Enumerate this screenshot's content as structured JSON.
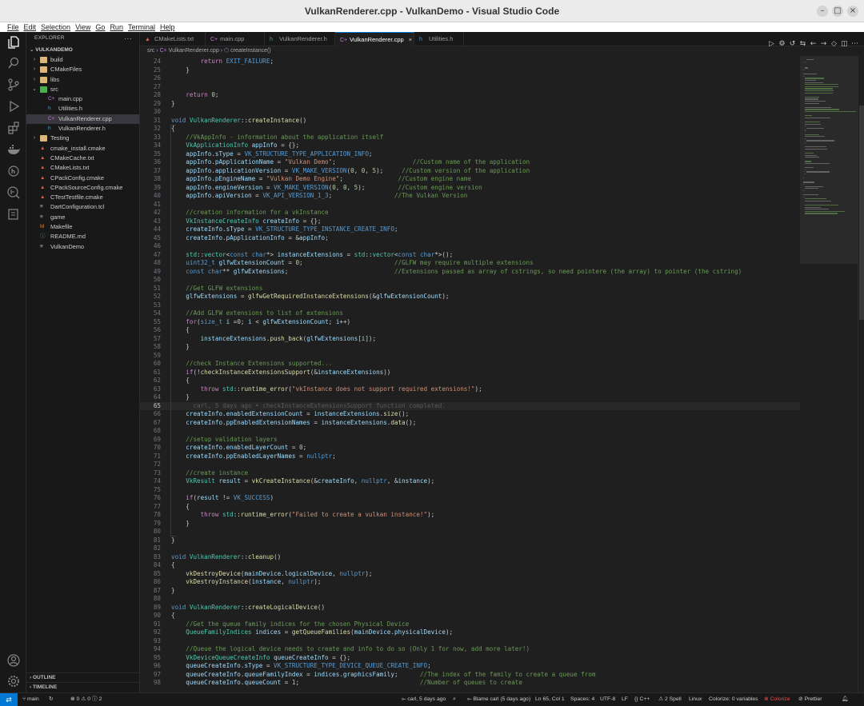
{
  "window": {
    "title": "VulkanRenderer.cpp - VulkanDemo - Visual Studio Code"
  },
  "menu": [
    "File",
    "Edit",
    "Selection",
    "View",
    "Go",
    "Run",
    "Terminal",
    "Help"
  ],
  "activity_icons": [
    "explorer-icon",
    "search-icon",
    "source-control-icon",
    "run-debug-icon",
    "extensions-icon",
    "docker-icon",
    "git-graph-icon",
    "gitlens-icon",
    "testing-icon",
    "account-icon",
    "settings-gear-icon"
  ],
  "sidebar": {
    "header": "EXPLORER",
    "more": "···",
    "root": "VULKANDEMO",
    "items": [
      {
        "name": "build",
        "kind": "folder",
        "depth": 0,
        "chevron": "›"
      },
      {
        "name": "CMakeFiles",
        "kind": "folder",
        "depth": 0,
        "chevron": "›"
      },
      {
        "name": "libs",
        "kind": "folder",
        "depth": 0,
        "chevron": "›"
      },
      {
        "name": "src",
        "kind": "folder-open",
        "depth": 0,
        "chevron": "⌄"
      },
      {
        "name": "main.cpp",
        "kind": "cpp",
        "depth": 1
      },
      {
        "name": "Utilities.h",
        "kind": "h",
        "depth": 1
      },
      {
        "name": "VulkanRenderer.cpp",
        "kind": "cpp",
        "depth": 1,
        "active": true
      },
      {
        "name": "VulkanRenderer.h",
        "kind": "h",
        "depth": 1
      },
      {
        "name": "Testing",
        "kind": "folder",
        "depth": 0,
        "chevron": "›"
      },
      {
        "name": "cmake_install.cmake",
        "kind": "cmake",
        "depth": 0
      },
      {
        "name": "CMakeCache.txt",
        "kind": "cmake",
        "depth": 0
      },
      {
        "name": "CMakeLists.txt",
        "kind": "cmake",
        "depth": 0
      },
      {
        "name": "CPackConfig.cmake",
        "kind": "cmake",
        "depth": 0
      },
      {
        "name": "CPackSourceConfig.cmake",
        "kind": "cmake",
        "depth": 0
      },
      {
        "name": "CTestTestfile.cmake",
        "kind": "cmake",
        "depth": 0
      },
      {
        "name": "DartConfiguration.tcl",
        "kind": "file",
        "depth": 0
      },
      {
        "name": "game",
        "kind": "file",
        "depth": 0
      },
      {
        "name": "Makefile",
        "kind": "makefile",
        "depth": 0
      },
      {
        "name": "README.md",
        "kind": "md",
        "depth": 0
      },
      {
        "name": "VulkanDemo",
        "kind": "file",
        "depth": 0
      }
    ],
    "outline": "OUTLINE",
    "timeline": "TIMELINE"
  },
  "tabs": [
    {
      "label": "CMakeLists.txt",
      "icon": "cmake"
    },
    {
      "label": "main.cpp",
      "icon": "cpp"
    },
    {
      "label": "VulkanRenderer.h",
      "icon": "h"
    },
    {
      "label": "VulkanRenderer.cpp",
      "icon": "cpp",
      "active": true,
      "close": "×"
    },
    {
      "label": "Utilities.h",
      "icon": "h"
    }
  ],
  "breadcrumb": {
    "folder": "src",
    "file": "VulkanRenderer.cpp",
    "symbol": "createInstance()"
  },
  "editor": {
    "current_line": 65,
    "lines": [
      {
        "n": 24,
        "code": "        return EXIT_FAILURE;"
      },
      {
        "n": 25,
        "code": "    }"
      },
      {
        "n": 26,
        "code": ""
      },
      {
        "n": 27,
        "code": ""
      },
      {
        "n": 28,
        "code": "    return 0;"
      },
      {
        "n": 29,
        "code": "}"
      },
      {
        "n": 30,
        "code": ""
      },
      {
        "n": 31,
        "code": "void VulkanRenderer::createInstance()"
      },
      {
        "n": 32,
        "code": "{"
      },
      {
        "n": 33,
        "code": "    //VkAppInfo - information about the application itself"
      },
      {
        "n": 34,
        "code": "    VkApplicationInfo appInfo = {};"
      },
      {
        "n": 35,
        "code": "    appInfo.sType = VK_STRUCTURE_TYPE_APPLICATION_INFO;"
      },
      {
        "n": 36,
        "code": "    appInfo.pApplicationName = \"Vulkan Demo\";                     //Custom name of the application"
      },
      {
        "n": 37,
        "code": "    appInfo.applicationVersion = VK_MAKE_VERSION(0, 0, 5);     //Custom version of the application"
      },
      {
        "n": 38,
        "code": "    appInfo.pEngineName = \"Vulkan Demo Engine\";               //Custom engine name"
      },
      {
        "n": 39,
        "code": "    appInfo.engineVersion = VK_MAKE_VERSION(0, 0, 5);         //Custom engine version"
      },
      {
        "n": 40,
        "code": "    appInfo.apiVersion = VK_API_VERSION_1_3;                 //The Vulkan Version"
      },
      {
        "n": 41,
        "code": ""
      },
      {
        "n": 42,
        "code": "    //creation information for a vkInstance"
      },
      {
        "n": 43,
        "code": "    VkInstanceCreateInfo createInfo = {};"
      },
      {
        "n": 44,
        "code": "    createInfo.sType = VK_STRUCTURE_TYPE_INSTANCE_CREATE_INFO;"
      },
      {
        "n": 45,
        "code": "    createInfo.pApplicationInfo = &appInfo;"
      },
      {
        "n": 46,
        "code": ""
      },
      {
        "n": 47,
        "code": "    std::vector<const char*> instanceExtensions = std::vector<const char*>();"
      },
      {
        "n": 48,
        "code": "    uint32_t glfwExtensionCount = 0;                         //GLFW may require multiple extensions"
      },
      {
        "n": 49,
        "code": "    const char** glfwExtensions;                             //Extensions passed as array of cstrings, so need pointere (the array) to pointer (the cstring)"
      },
      {
        "n": 50,
        "code": ""
      },
      {
        "n": 51,
        "code": "    //Get GLFW extensions"
      },
      {
        "n": 52,
        "code": "    glfwExtensions = glfwGetRequiredInstanceExtensions(&glfwExtensionCount);"
      },
      {
        "n": 53,
        "code": ""
      },
      {
        "n": 54,
        "code": "    //Add GLFW extensions to list of extensions"
      },
      {
        "n": 55,
        "code": "    for(size_t i =0; i < glfwExtensionCount; i++)"
      },
      {
        "n": 56,
        "code": "    {"
      },
      {
        "n": 57,
        "code": "        instanceExtensions.push_back(glfwExtensions[i]);"
      },
      {
        "n": 58,
        "code": "    }"
      },
      {
        "n": 59,
        "code": ""
      },
      {
        "n": 60,
        "code": "    //check Instance Extensions supported..."
      },
      {
        "n": 61,
        "code": "    if(!checkInstanceExtensionsSupport(&instanceExtensions))"
      },
      {
        "n": 62,
        "code": "    {"
      },
      {
        "n": 63,
        "code": "        throw std::runtime_error(\"vkInstance does not support required extensions!\");"
      },
      {
        "n": 64,
        "code": "    }"
      },
      {
        "n": 65,
        "code": "",
        "ghost": "      carl, 5 days ago • checkInstanceExtensionsSupport function completed."
      },
      {
        "n": 66,
        "code": "    createInfo.enabledExtensionCount = instanceExtensions.size();"
      },
      {
        "n": 67,
        "code": "    createInfo.ppEnabledExtensionNames = instanceExtensions.data();"
      },
      {
        "n": 68,
        "code": ""
      },
      {
        "n": 69,
        "code": "    //setup validation layers"
      },
      {
        "n": 70,
        "code": "    createInfo.enabledLayerCount = 0;"
      },
      {
        "n": 71,
        "code": "    createInfo.ppEnabledLayerNames = nullptr;"
      },
      {
        "n": 72,
        "code": ""
      },
      {
        "n": 73,
        "code": "    //create instance"
      },
      {
        "n": 74,
        "code": "    VkResult result = vkCreateInstance(&createInfo, nullptr, &instance);"
      },
      {
        "n": 75,
        "code": ""
      },
      {
        "n": 76,
        "code": "    if(result != VK_SUCCESS)"
      },
      {
        "n": 77,
        "code": "    {"
      },
      {
        "n": 78,
        "code": "        throw std::runtime_error(\"Failed to create a vulkan instance!\");"
      },
      {
        "n": 79,
        "code": "    }"
      },
      {
        "n": 80,
        "code": ""
      },
      {
        "n": 81,
        "code": "}"
      },
      {
        "n": 82,
        "code": ""
      },
      {
        "n": 83,
        "code": "void VulkanRenderer::cleanup()"
      },
      {
        "n": 84,
        "code": "{"
      },
      {
        "n": 85,
        "code": "    vkDestroyDevice(mainDevice.logicalDevice, nullptr);"
      },
      {
        "n": 86,
        "code": "    vkDestroyInstance(instance, nullptr);"
      },
      {
        "n": 87,
        "code": "}"
      },
      {
        "n": 88,
        "code": ""
      },
      {
        "n": 89,
        "code": "void VulkanRenderer::createLogicalDevice()"
      },
      {
        "n": 90,
        "code": "{"
      },
      {
        "n": 91,
        "code": "    //Get the queue family indices for the chosen Physical Device"
      },
      {
        "n": 92,
        "code": "    QueueFamilyIndices indices = getQueueFamilies(mainDevice.physicalDevice);"
      },
      {
        "n": 93,
        "code": ""
      },
      {
        "n": 94,
        "code": "    //Queue the logical device needs to create and info to do so (Only 1 for now, add more later!)"
      },
      {
        "n": 95,
        "code": "    VkDeviceQueueCreateInfo queueCreateInfo = {};"
      },
      {
        "n": 96,
        "code": "    queueCreateInfo.sType = VK_STRUCTURE_TYPE_DEVICE_QUEUE_CREATE_INFO;"
      },
      {
        "n": 97,
        "code": "    queueCreateInfo.queueFamilyIndex = indices.graphicsFamily;      //The index of the family to create a queue from"
      },
      {
        "n": 98,
        "code": "    queueCreateInfo.queueCount = 1;                                 //Number of queues to create"
      }
    ]
  },
  "statusbar": {
    "remote": "⇄",
    "branch": "main",
    "sync": "↻",
    "problems": "⊗ 0 ⚠ 0 ⓘ 2",
    "blame_author": "carl, 5 days ago",
    "blame_label": "Blame carl (5 days ago)",
    "position": "Ln 65, Col 1",
    "spaces": "Spaces: 4",
    "encoding": "UTF-8",
    "eol": "LF",
    "language": "C++",
    "spell": "2 Spell",
    "platform": "Linux",
    "colorize_vars": "Colorize: 0 variables",
    "colorize": "Colorize",
    "prettier": "Prettier"
  }
}
